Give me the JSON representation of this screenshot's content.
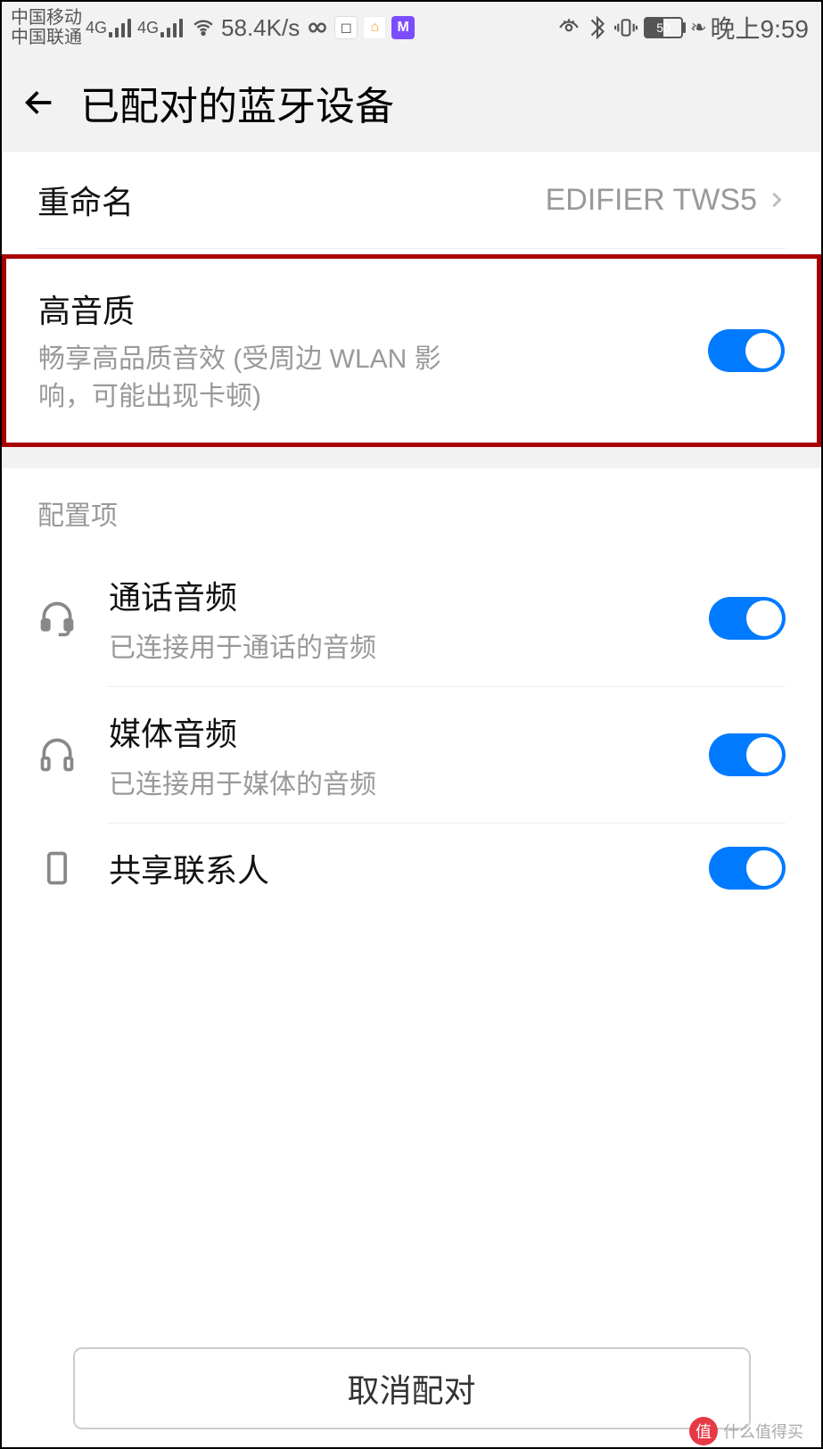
{
  "statusbar": {
    "carrier1": "中国移动",
    "carrier2": "中国联通",
    "net_gen": "4G",
    "speed": "58.4K/s",
    "battery_pct": "50",
    "clock": "晚上9:59"
  },
  "appbar": {
    "title": "已配对的蓝牙设备"
  },
  "rename": {
    "label": "重命名",
    "value": "EDIFIER TWS5"
  },
  "hq": {
    "title": "高音质",
    "desc": "畅享高品质音效 (受周边 WLAN 影响，可能出现卡顿)"
  },
  "section_label": "配置项",
  "cfg": [
    {
      "title": "通话音频",
      "sub": "已连接用于通话的音频"
    },
    {
      "title": "媒体音频",
      "sub": "已连接用于媒体的音频"
    },
    {
      "title": "共享联系人",
      "sub": ""
    }
  ],
  "footer": {
    "unpair": "取消配对"
  },
  "watermark": "什么值得买"
}
